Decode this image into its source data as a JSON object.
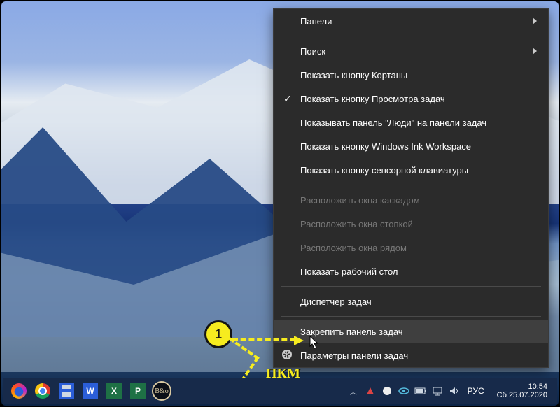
{
  "ctx": {
    "panels": "Панели",
    "search": "Поиск",
    "cortana": "Показать кнопку Кортаны",
    "taskview": "Показать кнопку Просмотра задач",
    "people": "Показывать панель \"Люди\" на панели задач",
    "ink": "Показать кнопку Windows Ink Workspace",
    "touchkb": "Показать кнопку сенсорной клавиатуры",
    "cascade": "Расположить окна каскадом",
    "stack": "Расположить окна стопкой",
    "sidebyside": "Расположить окна рядом",
    "showdesktop": "Показать рабочий стол",
    "taskmgr": "Диспетчер задач",
    "locktb": "Закрепить панель задач",
    "tbsettings": "Параметры панели задач"
  },
  "annot": {
    "step": "1",
    "pkm": "ПКМ"
  },
  "tb": {
    "word": "W",
    "excel": "X",
    "pub": "P",
    "bo": "B&o",
    "lang": "РУС",
    "time": "10:54",
    "date": "Сб 25.07.2020"
  }
}
